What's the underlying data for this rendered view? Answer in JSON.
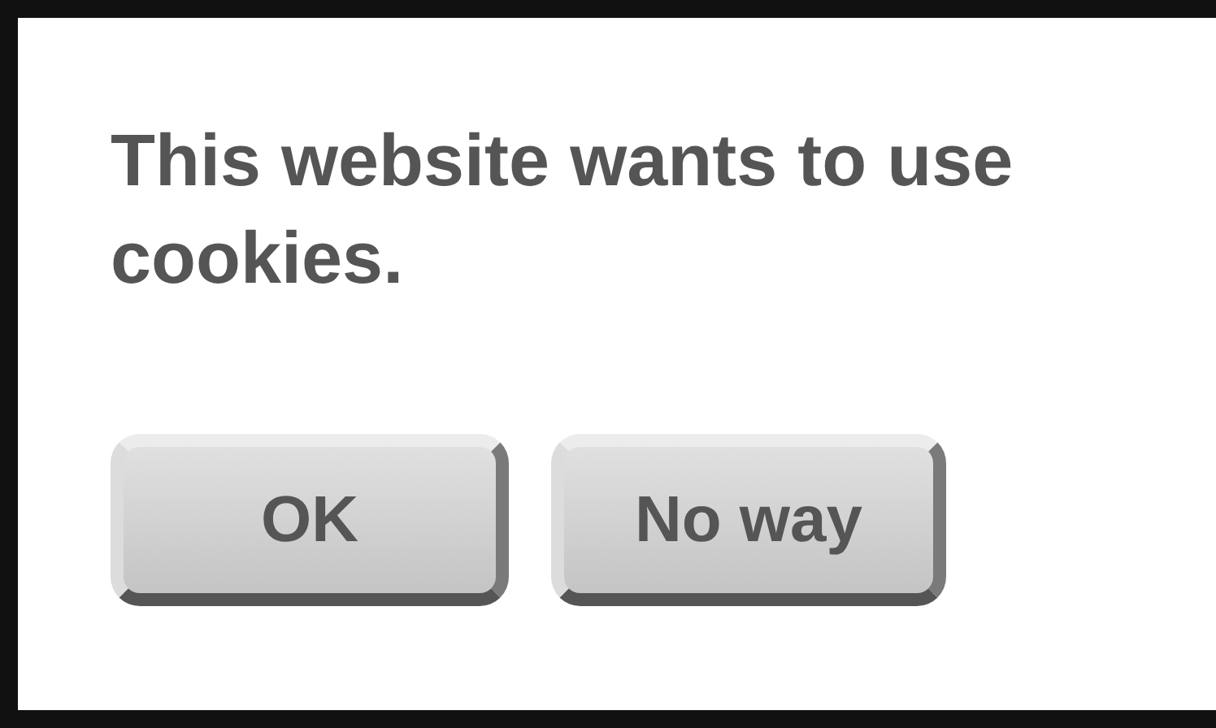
{
  "dialog": {
    "message": "This website wants to use cookies.",
    "buttons": [
      {
        "label": "OK"
      },
      {
        "label": "No way"
      }
    ]
  }
}
